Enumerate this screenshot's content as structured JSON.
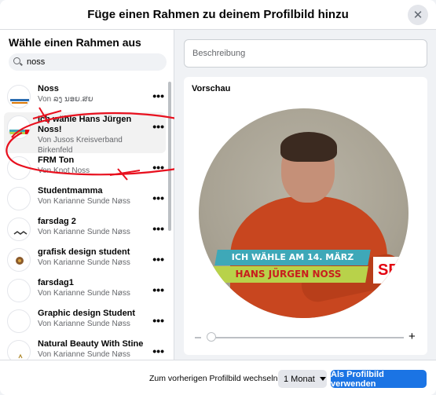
{
  "modal": {
    "title": "Füge einen Rahmen zu deinem Profilbild hinzu"
  },
  "left_panel": {
    "title": "Wähle einen Rahmen aus",
    "search": {
      "value": "noss",
      "placeholder": ""
    },
    "frames": [
      {
        "name": "Noss",
        "by": "Von ລງ ນອຍ.ສຍ",
        "more": "•••"
      },
      {
        "name": "Ich wähle Hans Jürgen Noss!",
        "by": "Von Jusos Kreisverband Birkenfeld",
        "more": "•••"
      },
      {
        "name": "FRM Ton",
        "by": "Von Knot Noss",
        "more": "•••"
      },
      {
        "name": "Studentmamma",
        "by": "Von Karianne Sunde Nøss",
        "more": "•••"
      },
      {
        "name": "farsdag 2",
        "by": "Von Karianne Sunde Nøss",
        "more": "•••"
      },
      {
        "name": "grafisk design student",
        "by": "Von Karianne Sunde Nøss",
        "more": "•••"
      },
      {
        "name": "farsdag1",
        "by": "Von Karianne Sunde Nøss",
        "more": "•••"
      },
      {
        "name": "Graphic design Student",
        "by": "Von Karianne Sunde Nøss",
        "more": "•••"
      },
      {
        "name": "Natural Beauty With Stine",
        "by": "Von Karianne Sunde Nøss",
        "more": "•••"
      }
    ]
  },
  "right_panel": {
    "description_placeholder": "Beschreibung",
    "preview_title": "Vorschau",
    "frame_text_line1": "ICH WÄHLE AM 14. MÄRZ",
    "frame_text_line2": "HANS JÜRGEN NOSS",
    "frame_logo": "SPD",
    "zoom_minus": "−",
    "zoom_plus": "+"
  },
  "footer": {
    "switch_label": "Zum vorherigen Profilbild wechseln in",
    "duration": "1 Monat",
    "primary_button": "Als Profilbild verwenden"
  },
  "colors": {
    "accent": "#1b74e4",
    "annotation": "#e8101e",
    "banner_teal": "#3ea8b8",
    "banner_green": "#b8d24a",
    "spd_red": "#e3000f"
  }
}
